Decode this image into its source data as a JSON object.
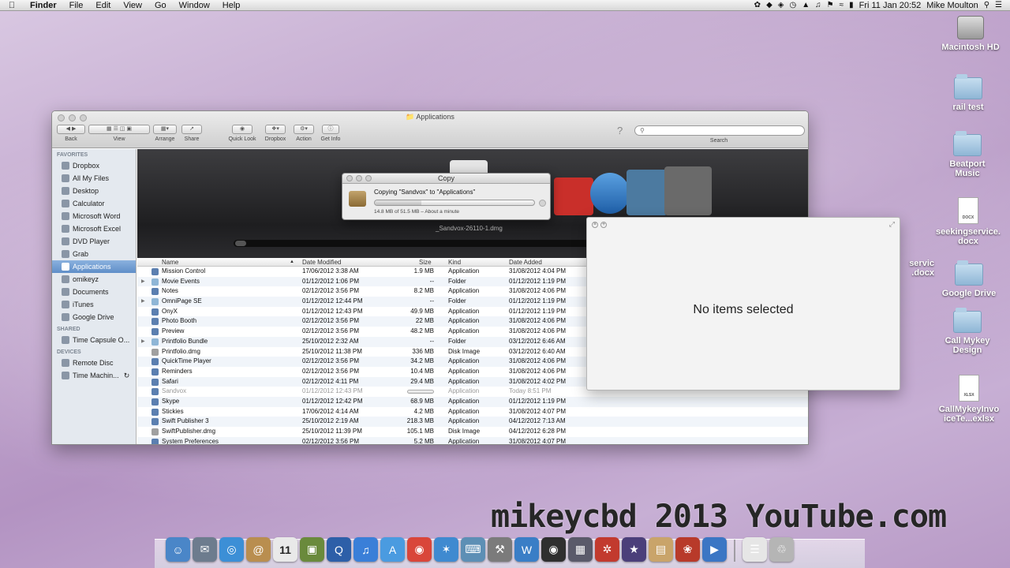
{
  "menubar": {
    "apple": "",
    "items": [
      "Finder",
      "File",
      "Edit",
      "View",
      "Go",
      "Window",
      "Help"
    ],
    "clock": "Fri 11 Jan  20:52",
    "user": "Mike Moulton"
  },
  "desktop": {
    "icons": [
      {
        "label": "Macintosh HD",
        "icon": "hard-drive-icon"
      },
      {
        "label": "rail test",
        "icon": "folder-icon"
      },
      {
        "label": "Beatport Music",
        "icon": "folder-icon"
      },
      {
        "label": "seekingservice.docx",
        "icon": "document-icon"
      },
      {
        "label": "Google Drive",
        "icon": "folder-icon"
      },
      {
        "label": "Call Mykey Design",
        "icon": "folder-icon"
      },
      {
        "label": "CallMykeyInvoiceTe...exlsx",
        "icon": "spreadsheet-icon"
      }
    ],
    "partial_label_1": "servic",
    "partial_label_2": ".docx"
  },
  "finder": {
    "title": "Applications",
    "toolbar": {
      "back": "Back",
      "view": "View",
      "arrange": "Arrange",
      "share": "Share",
      "quick_look": "Quick Look",
      "dropbox": "Dropbox",
      "action": "Action",
      "get_info": "Get Info",
      "search": "Search"
    },
    "sidebar": {
      "favorites_head": "FAVORITES",
      "favorites": [
        "Dropbox",
        "All My Files",
        "Desktop",
        "Calculator",
        "Microsoft Word",
        "Microsoft Excel",
        "DVD Player",
        "Grab",
        "Applications",
        "omikeyz",
        "Documents",
        "iTunes",
        "Google Drive"
      ],
      "shared_head": "SHARED",
      "shared": [
        "Time Capsule O..."
      ],
      "devices_head": "DEVICES",
      "devices": [
        "Remote Disc",
        "Time Machin..."
      ]
    },
    "coverflow_label": "_Sandvox-26110-1.dmg",
    "columns": {
      "name": "Name",
      "date_modified": "Date Modified",
      "size": "Size",
      "kind": "Kind",
      "date_added": "Date Added"
    },
    "rows": [
      {
        "name": "Mission Control",
        "modified": "17/06/2012 3:38 AM",
        "size": "1.9 MB",
        "kind": "Application",
        "added": "31/08/2012 4:04 PM",
        "folder": false
      },
      {
        "name": "Movie Events",
        "modified": "01/12/2012 1:06 PM",
        "size": "--",
        "kind": "Folder",
        "added": "01/12/2012 1:19 PM",
        "folder": true
      },
      {
        "name": "Notes",
        "modified": "02/12/2012 3:56 PM",
        "size": "8.2 MB",
        "kind": "Application",
        "added": "31/08/2012 4:06 PM",
        "folder": false
      },
      {
        "name": "OmniPage SE",
        "modified": "01/12/2012 12:44 PM",
        "size": "--",
        "kind": "Folder",
        "added": "01/12/2012 1:19 PM",
        "folder": true
      },
      {
        "name": "OnyX",
        "modified": "01/12/2012 12:43 PM",
        "size": "49.9 MB",
        "kind": "Application",
        "added": "01/12/2012 1:19 PM",
        "folder": false
      },
      {
        "name": "Photo Booth",
        "modified": "02/12/2012 3:56 PM",
        "size": "22 MB",
        "kind": "Application",
        "added": "31/08/2012 4:06 PM",
        "folder": false
      },
      {
        "name": "Preview",
        "modified": "02/12/2012 3:56 PM",
        "size": "48.2 MB",
        "kind": "Application",
        "added": "31/08/2012 4:06 PM",
        "folder": false
      },
      {
        "name": "Printfolio Bundle",
        "modified": "25/10/2012 2:32 AM",
        "size": "--",
        "kind": "Folder",
        "added": "03/12/2012 6:46 AM",
        "folder": true
      },
      {
        "name": "Printfolio.dmg",
        "modified": "25/10/2012 11:38 PM",
        "size": "336 MB",
        "kind": "Disk Image",
        "added": "03/12/2012 6:40 AM",
        "folder": false
      },
      {
        "name": "QuickTime Player",
        "modified": "02/12/2012 3:56 PM",
        "size": "34.2 MB",
        "kind": "Application",
        "added": "31/08/2012 4:06 PM",
        "folder": false
      },
      {
        "name": "Reminders",
        "modified": "02/12/2012 3:56 PM",
        "size": "10.4 MB",
        "kind": "Application",
        "added": "31/08/2012 4:06 PM",
        "folder": false
      },
      {
        "name": "Safari",
        "modified": "02/12/2012 4:11 PM",
        "size": "29.4 MB",
        "kind": "Application",
        "added": "31/08/2012 4:02 PM",
        "folder": false
      },
      {
        "name": "Sandvox",
        "modified": "01/12/2012 12:43 PM",
        "size": "",
        "kind": "Application",
        "added": "Today 8:51 PM",
        "folder": false,
        "copying": true
      },
      {
        "name": "Skype",
        "modified": "01/12/2012 12:42 PM",
        "size": "68.9 MB",
        "kind": "Application",
        "added": "01/12/2012 1:19 PM",
        "folder": false
      },
      {
        "name": "Stickies",
        "modified": "17/06/2012 4:14 AM",
        "size": "4.2 MB",
        "kind": "Application",
        "added": "31/08/2012 4:07 PM",
        "folder": false
      },
      {
        "name": "Swift Publisher 3",
        "modified": "25/10/2012 2:19 AM",
        "size": "218.3 MB",
        "kind": "Application",
        "added": "04/12/2012 7:13 AM",
        "folder": false
      },
      {
        "name": "SwiftPublisher.dmg",
        "modified": "25/10/2012 11:39 PM",
        "size": "105.1 MB",
        "kind": "Disk Image",
        "added": "04/12/2012 6:28 PM",
        "folder": false
      },
      {
        "name": "System Preferences",
        "modified": "02/12/2012 3:56 PM",
        "size": "5.2 MB",
        "kind": "Application",
        "added": "31/08/2012 4:07 PM",
        "folder": false
      }
    ]
  },
  "copy_dialog": {
    "title": "Copy",
    "message": "Copying \"Sandvox\" to \"Applications\"",
    "detail": "14.8 MB of 51.5 MB – About a minute",
    "progress": 0.29
  },
  "inspector": {
    "message": "No items selected"
  },
  "watermark": "mikeycbd 2013 YouTube.com",
  "dock": {
    "items": [
      {
        "icon": "finder-icon",
        "color": "#4a86c8"
      },
      {
        "icon": "mail-icon",
        "color": "#6d7c8e"
      },
      {
        "icon": "safari-icon",
        "color": "#3c8fd6"
      },
      {
        "icon": "address-book-icon",
        "color": "#b98e4f"
      },
      {
        "icon": "calendar-icon",
        "color": "#e9e9e9"
      },
      {
        "icon": "iphoto-icon",
        "color": "#6a8a3c"
      },
      {
        "icon": "quicktime-icon",
        "color": "#2d5fa8"
      },
      {
        "icon": "itunes-icon",
        "color": "#3a7fd8"
      },
      {
        "icon": "app-store-icon",
        "color": "#4a9be0"
      },
      {
        "icon": "chrome-icon",
        "color": "#d9463a"
      },
      {
        "icon": "network-icon",
        "color": "#3f8ad0"
      },
      {
        "icon": "keyboard-icon",
        "color": "#5d8fb5"
      },
      {
        "icon": "onyx-icon",
        "color": "#7b7b7b"
      },
      {
        "icon": "sandvox-icon",
        "color": "#3a7ec6"
      },
      {
        "icon": "dvd-player-icon",
        "color": "#2f2f2f"
      },
      {
        "icon": "final-cut-icon",
        "color": "#5a5a6a"
      },
      {
        "icon": "compass-icon",
        "color": "#c23a2e"
      },
      {
        "icon": "wizard-icon",
        "color": "#4b3f7a"
      },
      {
        "icon": "preview-icon",
        "color": "#c9a46a"
      },
      {
        "icon": "ladybug-icon",
        "color": "#b83a2a"
      },
      {
        "icon": "quicktime-player-icon",
        "color": "#3b76c4"
      }
    ],
    "trailing": [
      {
        "icon": "documents-stack-icon",
        "color": "#e6e6e6"
      },
      {
        "icon": "trash-icon",
        "color": "#b5b5b5"
      }
    ]
  }
}
